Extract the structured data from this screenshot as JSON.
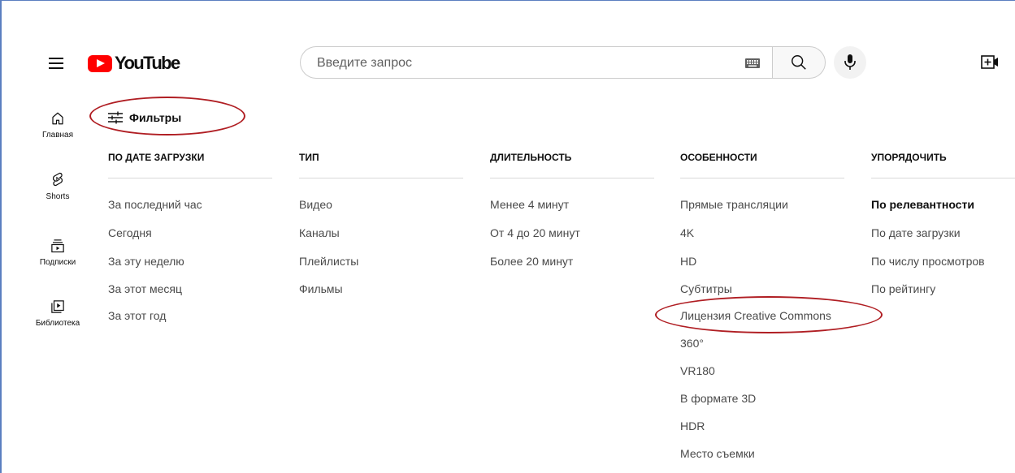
{
  "header": {
    "logo_text": "YouTube",
    "search_placeholder": "Введите запрос",
    "icons": [
      "menu-icon",
      "keyboard-icon",
      "search-icon",
      "microphone-icon",
      "create-icon"
    ]
  },
  "guide": {
    "items": [
      {
        "label": "Главная",
        "icon": "home-icon"
      },
      {
        "label": "Shorts",
        "icon": "shorts-icon"
      },
      {
        "label": "Подписки",
        "icon": "subscriptions-icon"
      },
      {
        "label": "Библиотека",
        "icon": "library-icon"
      }
    ]
  },
  "filters": {
    "button_label": "Фильтры",
    "columns": [
      {
        "title": "ПО ДАТЕ ЗАГРУЗКИ",
        "items": [
          "За последний час",
          "Сегодня",
          "За эту неделю",
          "За этот месяц",
          "За этот год"
        ]
      },
      {
        "title": "ТИП",
        "items": [
          "Видео",
          "Каналы",
          "Плейлисты",
          "Фильмы"
        ]
      },
      {
        "title": "ДЛИТЕЛЬНОСТЬ",
        "items": [
          "Менее 4 минут",
          "От 4 до 20 минут",
          "Более 20 минут"
        ]
      },
      {
        "title": "ОСОБЕННОСТИ",
        "items": [
          "Прямые трансляции",
          "4K",
          "HD",
          "Субтитры",
          "Лицензия Creative Commons",
          "360°",
          "VR180",
          "В формате 3D",
          "HDR",
          "Место съемки"
        ]
      },
      {
        "title": "УПОРЯДОЧИТЬ",
        "items": [
          "По релевантности",
          "По дате загрузки",
          "По числу просмотров",
          "По рейтингу"
        ],
        "active": "По релевантности"
      }
    ]
  },
  "colors": {
    "brand_red": "#ff0000",
    "highlight_oval": "#b01e23",
    "frame": "#5b7fc0"
  }
}
